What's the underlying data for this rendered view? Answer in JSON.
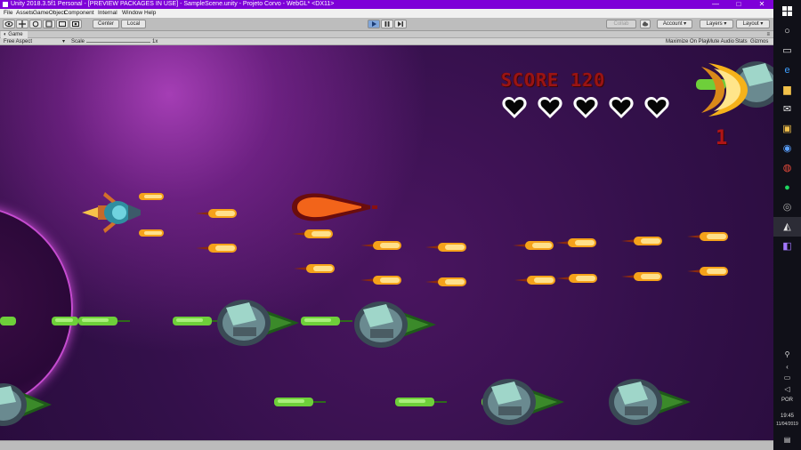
{
  "window": {
    "title": "Unity 2018.3.5f1 Personal - [PREVIEW PACKAGES IN USE] - SampleScene.unity - Projeto Corvo - WebGL* <DX11>",
    "controls": [
      "—",
      "□",
      "✕"
    ]
  },
  "menu": [
    "File",
    "Assets",
    "GameObject",
    "Component",
    "Internal",
    "Window",
    "Help"
  ],
  "toolbar": {
    "pivot": "Center",
    "space": "Local",
    "collab": "Collab",
    "account": "Account",
    "layers": "Layers",
    "layout": "Layout"
  },
  "game_tab": {
    "label": "Game",
    "aspect": "Free Aspect",
    "scale_label": "Scale",
    "scale_value": "1x",
    "maximize": "Maximize On Play",
    "mute": "Mute Audio",
    "stats": "Stats",
    "gizmos": "Gizmos"
  },
  "hud": {
    "score_label": "SCORE",
    "score_value": "120",
    "hearts": 5,
    "lives": "1"
  },
  "taskbar": {
    "lang": "POR",
    "time": "19:45",
    "date": "11/04/2019"
  },
  "colors": {
    "title_bar": "#7e00d8",
    "score_red": "#9a1414",
    "bullet_orange": "#f5a21a",
    "enemy_green": "#6ecf3a"
  }
}
